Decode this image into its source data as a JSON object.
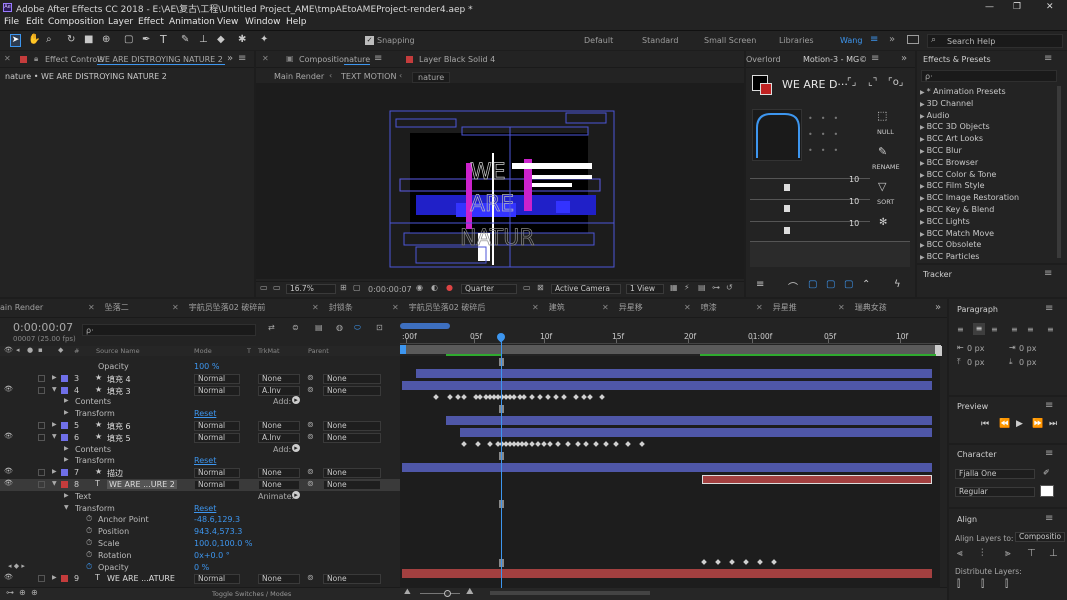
{
  "window": {
    "title": "Adobe After Effects CC 2018 - E:\\AE\\复古\\工程\\Untitled Project_AME\\tmpAEtoAMEProject-render4.aep *",
    "min": "—",
    "max": "❐",
    "close": "✕"
  },
  "menu": [
    "File",
    "Edit",
    "Composition",
    "Layer",
    "Effect",
    "Animation",
    "View",
    "Window",
    "Help"
  ],
  "toolbar": {
    "snapping": "Snapping",
    "workspaces": [
      "Default",
      "Standard",
      "Small Screen",
      "Libraries",
      "Wang"
    ],
    "active_workspace": "Wang",
    "search": "Search Help"
  },
  "effect_controls": {
    "tab_label": "Effect Controls",
    "tab_value": "WE ARE  DISTROYING  NATURE 2",
    "header": "nature • WE ARE   DISTROYING   NATURE 2"
  },
  "composition": {
    "tab_label": "Composition",
    "tab_value": "nature",
    "layer_tab": "Layer Black Solid 4",
    "crumbs": [
      "Main Render",
      "TEXT MOTION",
      "nature"
    ],
    "zoom": "16.7%",
    "time": "0:00:00:07",
    "resolution": "Quarter",
    "camera": "Active Camera",
    "views": "1 View"
  },
  "motion": {
    "tab_left": "Overlord",
    "tab": "Motion-3 - MG©",
    "title": "WE ARE D···",
    "buttons": [
      "NULL",
      "RENAME",
      "SORT"
    ],
    "slider_vals": [
      "10",
      "10",
      "10"
    ]
  },
  "effects_presets": {
    "title": "Effects & Presets",
    "search": "ρ·",
    "items": [
      "* Animation Presets",
      "3D Channel",
      "Audio",
      "BCC 3D Objects",
      "BCC Art Looks",
      "BCC Blur",
      "BCC Browser",
      "BCC Color & Tone",
      "BCC Film Style",
      "BCC Image Restoration",
      "BCC Key & Blend",
      "BCC Lights",
      "BCC Match Move",
      "BCC Obsolete",
      "BCC Particles"
    ]
  },
  "tracker": {
    "title": "Tracker"
  },
  "timeline": {
    "tabs": [
      "ain Render",
      "坠落二",
      "宇航员坠落02 破碎前",
      "封锁条",
      "宇航员坠落02 破碎后",
      "建筑",
      "异星移",
      "喷漆",
      "异星推",
      "瑞典女孩"
    ],
    "time": "0:00:00:07",
    "fps": "00007 (25.00 fps)",
    "search": "ρ·",
    "cols": [
      "#",
      "Source Name",
      "Mode",
      "T",
      "TrkMat",
      "Parent"
    ],
    "ruler": [
      ":00f",
      "05f",
      "10f",
      "15f",
      "20f",
      "01:00f",
      "05f",
      "10f"
    ],
    "rows": [
      {
        "kind": "prop",
        "name": "Opacity",
        "val": "100 %"
      },
      {
        "kind": "layer",
        "num": "3",
        "name": "填充 4",
        "mode": "Normal",
        "trk": "None",
        "parent": "None",
        "color": "#6f6fe8"
      },
      {
        "kind": "layer",
        "num": "4",
        "name": "填充 3",
        "mode": "Normal",
        "trk": "A.Inv",
        "parent": "None",
        "color": "#6f6fe8"
      },
      {
        "kind": "group",
        "name": "Contents",
        "add": "Add:"
      },
      {
        "kind": "group",
        "name": "Transform",
        "val": "Reset"
      },
      {
        "kind": "layer",
        "num": "5",
        "name": "填充 6",
        "mode": "Normal",
        "trk": "None",
        "parent": "None",
        "color": "#6f6fe8"
      },
      {
        "kind": "layer",
        "num": "6",
        "name": "填充 5",
        "mode": "Normal",
        "trk": "A.Inv",
        "parent": "None",
        "color": "#6f6fe8"
      },
      {
        "kind": "group",
        "name": "Contents",
        "add": "Add:"
      },
      {
        "kind": "group",
        "name": "Transform",
        "val": "Reset"
      },
      {
        "kind": "layer",
        "num": "7",
        "name": "描边",
        "mode": "Normal",
        "trk": "None",
        "parent": "None",
        "color": "#6f6fe8"
      },
      {
        "kind": "layer",
        "num": "8",
        "name": "WE ARE ...URE 2",
        "mode": "Normal",
        "trk": "None",
        "parent": "None",
        "color": "#c43c3c"
      },
      {
        "kind": "group",
        "name": "Text",
        "add": "Animate:"
      },
      {
        "kind": "group",
        "name": "Transform",
        "val": "Reset"
      },
      {
        "kind": "prop",
        "name": "Anchor Point",
        "val": "-48.6,129.3"
      },
      {
        "kind": "prop",
        "name": "Position",
        "val": "943.4,573.3"
      },
      {
        "kind": "prop",
        "name": "Scale",
        "val": "100.0,100.0 %"
      },
      {
        "kind": "prop",
        "name": "Rotation",
        "val": "0x+0.0 °"
      },
      {
        "kind": "prop",
        "name": "Opacity",
        "val": "0 %"
      },
      {
        "kind": "layer",
        "num": "9",
        "name": "WE ARE ...ATURE",
        "mode": "Normal",
        "trk": "None",
        "parent": "None",
        "color": "#c43c3c"
      }
    ],
    "footer": "Toggle Switches / Modes"
  },
  "paragraph": {
    "title": "Paragraph",
    "vals": [
      "0 px",
      "0 px",
      "0 px",
      "0 px",
      "0 px"
    ]
  },
  "preview": {
    "title": "Preview"
  },
  "character": {
    "title": "Character",
    "font": "Fjalla One",
    "style": "Regular"
  },
  "align": {
    "title": "Align",
    "align_to_label": "Align Layers to:",
    "align_to": "Compositio",
    "distribute": "Distribute Layers:"
  },
  "colors": {
    "accent": "#3d96ef",
    "layer_purple": "#6f6fe8",
    "layer_red": "#c43c3c",
    "bg": "#1d1d1d"
  }
}
